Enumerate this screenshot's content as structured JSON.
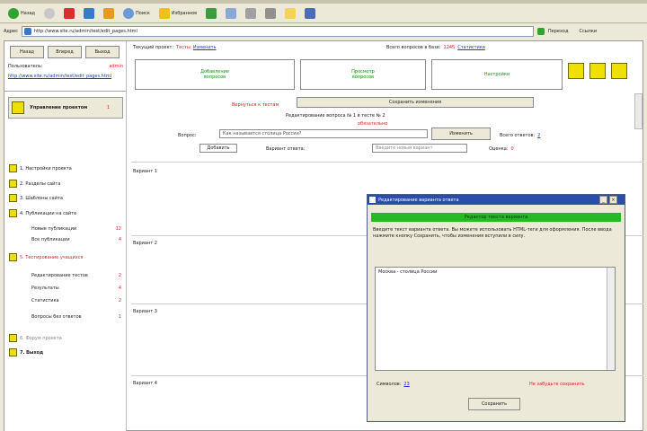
{
  "browser": {
    "back_label": "Назад",
    "search_label": "Поиск",
    "favorites_label": "Избранное",
    "address_label": "Адрес",
    "address_value": "http://www.site.ru/admin/test/edit_pages.html",
    "go_label": "Переход",
    "links_label": "Ссылки"
  },
  "left": {
    "buttons": [
      "Назад",
      "Вперед",
      "Выход"
    ],
    "user_label": "Пользователь:",
    "user_value": "admin",
    "link_text": "http://www.site.ru/admin/test/edit_pages.html",
    "menu": [
      {
        "label": "Управление проектом",
        "count": "1"
      },
      {
        "label": "1. Настройки проекта",
        "count": ""
      },
      {
        "label": "2. Разделы сайта",
        "count": ""
      },
      {
        "label": "3. Шаблоны сайта",
        "count": ""
      },
      {
        "label": "4. Публикации на сайте",
        "count": ""
      }
    ],
    "menu4_sub": [
      {
        "label": "Новые публикации",
        "count": "12"
      },
      {
        "label": "Все публикации",
        "count": "4"
      }
    ],
    "menu5": {
      "label": "5. Тестирование учащихся",
      "count": ""
    },
    "menu5_sub": [
      {
        "label": "Редактирование тестов",
        "count": "2"
      },
      {
        "label": "Результаты",
        "count": "4"
      },
      {
        "label": "Статистика",
        "count": "2"
      },
      {
        "label": "Вопросы без ответов",
        "count": "1"
      }
    ],
    "menu6": {
      "label": "6. Форум проекта"
    },
    "menu7": {
      "label": "7. Выход"
    }
  },
  "header": {
    "proj_label": "Текущий проект:",
    "proj_name": "Тесты",
    "proj_link": "Изменить",
    "stat_label": "Всего вопросов в базе:",
    "stat_value": "1245",
    "stat_link": "Статистика",
    "tabs": [
      {
        "line1": "Добавление",
        "line2": "вопросов"
      },
      {
        "line1": "Просмотр",
        "line2": "вопросов"
      },
      {
        "line1": "Настройки",
        "line2": ""
      }
    ],
    "tool_icons": [
      "tool-1-icon",
      "tool-2-icon",
      "tool-3-icon"
    ]
  },
  "form": {
    "red_link": "Вернуться к тестам",
    "save_button": "Сохранить изменения",
    "subtitle": "Редактирование вопроса № 1 в тесте № 2",
    "required": "обязательно",
    "question_label": "Вопрос:",
    "question_value": "Как называется столица России?",
    "edit_button": "Изменить",
    "answers_label": "Всего ответов:",
    "answers_value": "2",
    "add_label": "Добавить",
    "variant_label": "Вариант ответа:",
    "variant_value": "Введите новый вариант",
    "rating_label": "Оценка:",
    "rating_value": "0"
  },
  "sections": [
    "Вариант 1",
    "Вариант 2",
    "Вариант 3",
    "Вариант 4"
  ],
  "dialog": {
    "title": "Редактирование варианта ответа",
    "header": "Редактор текста варианта",
    "desc": "Введите текст варианта ответа. Вы можете использовать HTML-теги для оформления. После ввода нажмите кнопку Сохранить, чтобы изменения вступили в силу.",
    "textarea_value": "Москва - столица России",
    "count_label": "Символов:",
    "count_value": "23",
    "warn": "Не забудьте сохранить",
    "save_button": "Сохранить"
  }
}
